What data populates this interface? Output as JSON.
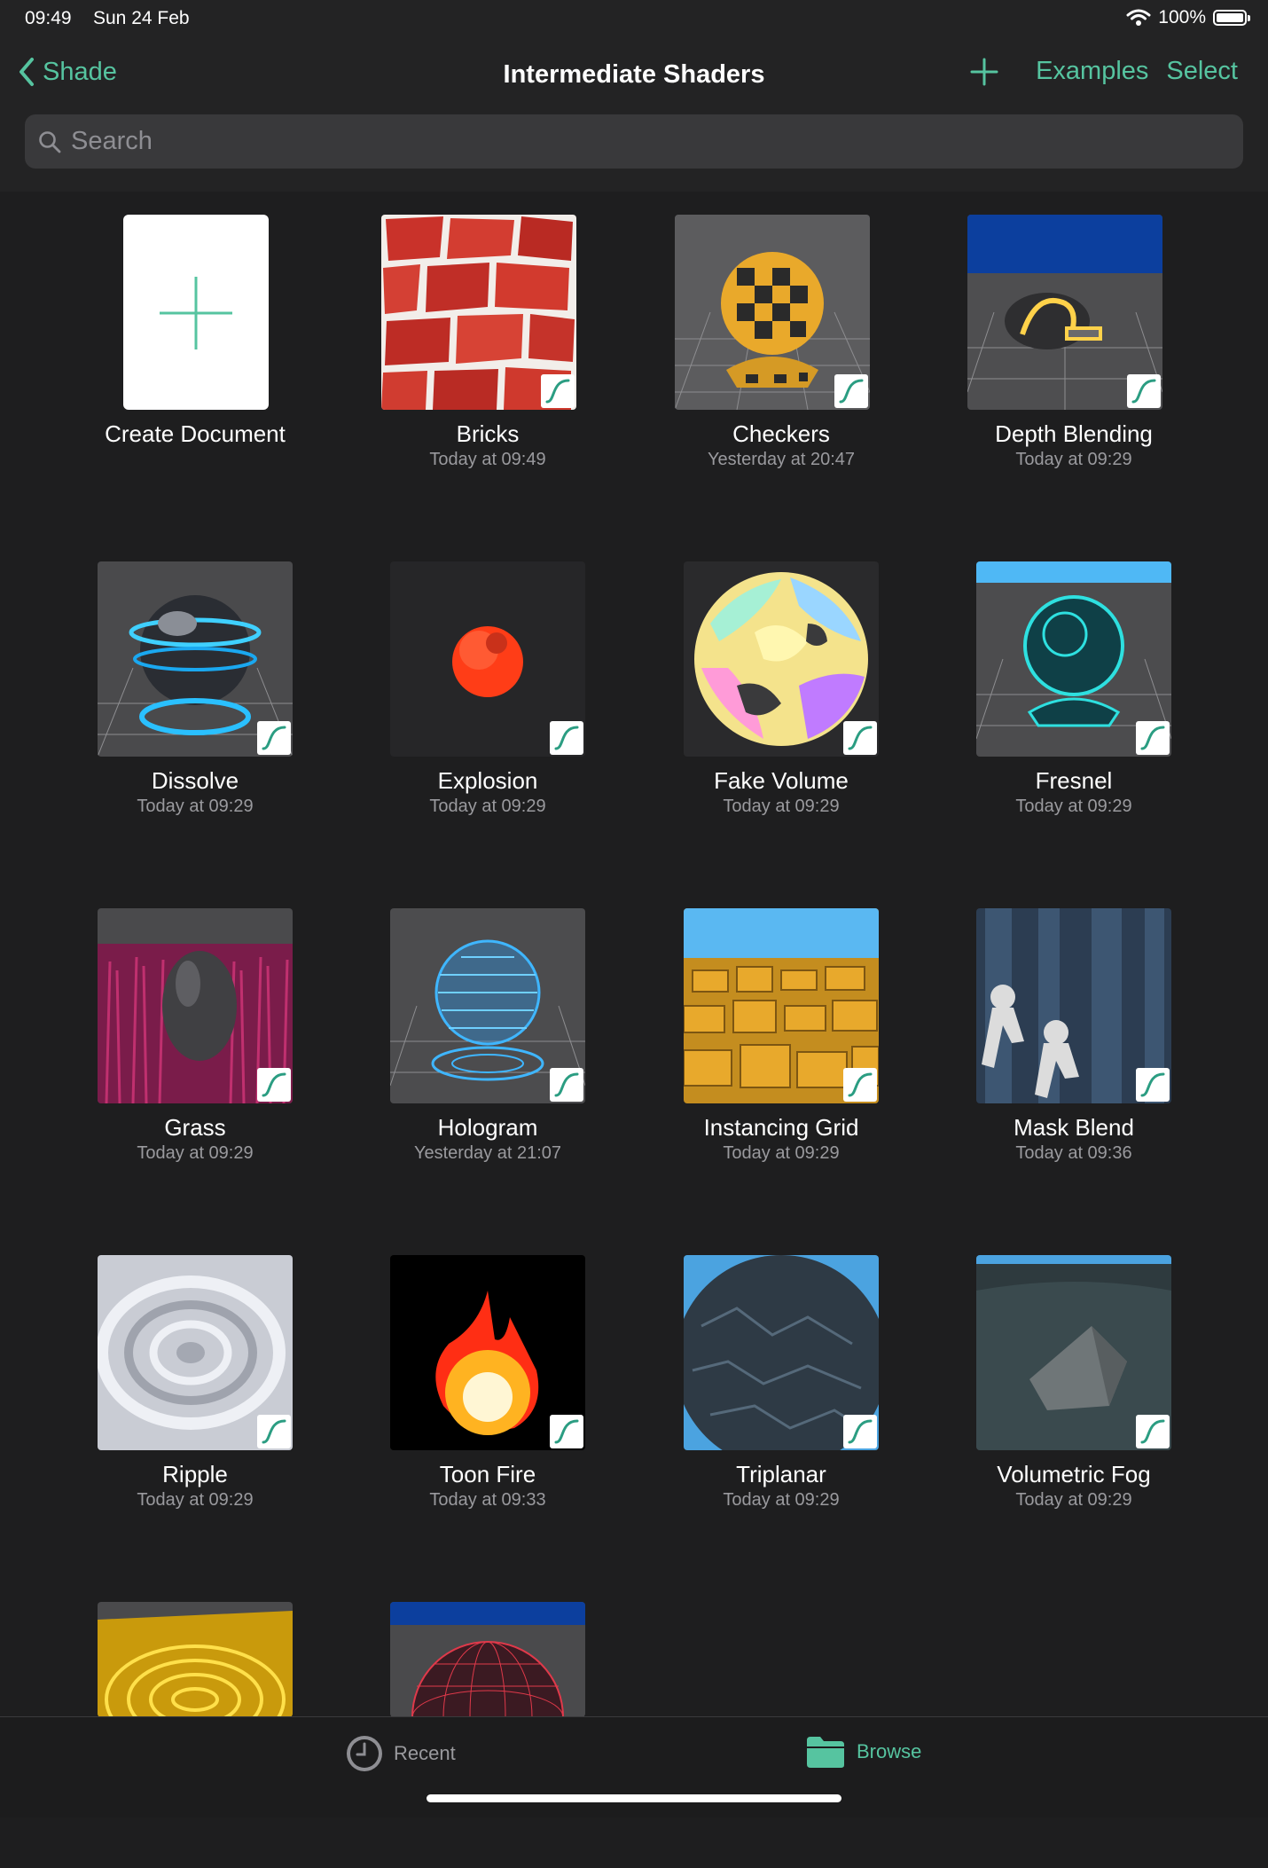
{
  "status": {
    "time": "09:49",
    "date": "Sun 24 Feb",
    "battery": "100%"
  },
  "nav": {
    "back_label": "Shade",
    "title": "Intermediate Shaders",
    "examples_label": "Examples",
    "select_label": "Select"
  },
  "search": {
    "placeholder": "Search",
    "value": ""
  },
  "create_document": {
    "label": "Create Document"
  },
  "items": [
    {
      "name": "Bricks",
      "date": "Today at 09:49"
    },
    {
      "name": "Checkers",
      "date": "Yesterday at 20:47"
    },
    {
      "name": "Depth Blending",
      "date": "Today at 09:29"
    },
    {
      "name": "Dissolve",
      "date": "Today at 09:29"
    },
    {
      "name": "Explosion",
      "date": "Today at 09:29"
    },
    {
      "name": "Fake Volume",
      "date": "Today at 09:29"
    },
    {
      "name": "Fresnel",
      "date": "Today at 09:29"
    },
    {
      "name": "Grass",
      "date": "Today at 09:29"
    },
    {
      "name": "Hologram",
      "date": "Yesterday at 21:07"
    },
    {
      "name": "Instancing Grid",
      "date": "Today at 09:29"
    },
    {
      "name": "Mask Blend",
      "date": "Today at 09:36"
    },
    {
      "name": "Ripple",
      "date": "Today at 09:29"
    },
    {
      "name": "Toon Fire",
      "date": "Today at 09:33"
    },
    {
      "name": "Triplanar",
      "date": "Today at 09:29"
    },
    {
      "name": "Volumetric Fog",
      "date": "Today at 09:29"
    }
  ],
  "tabs": {
    "recent": "Recent",
    "browse": "Browse"
  },
  "colors": {
    "accent": "#56c4a0",
    "background": "#1e1e1f",
    "header": "#232324",
    "secondary_text": "#9a9a9e"
  },
  "icons": {
    "back": "chevron-left-icon",
    "add": "plus-icon",
    "search": "magnifier-icon",
    "badge": "shader-curve-icon",
    "recent": "clock-icon",
    "browse": "folder-icon"
  }
}
